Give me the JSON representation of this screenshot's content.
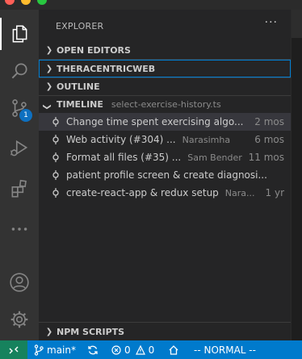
{
  "sidebar": {
    "title": "EXPLORER",
    "more_label": "···",
    "sections": {
      "open_editors": "OPEN EDITORS",
      "project": "THERACENTRICWEB",
      "outline": "OUTLINE",
      "timeline": "TIMELINE",
      "timeline_file": "select-exercise-history.ts",
      "npm_scripts": "NPM SCRIPTS"
    },
    "timeline_items": [
      {
        "title": "Change time spent exercising algo...",
        "author": "",
        "time": "2 mos"
      },
      {
        "title": "Web activity (#304) ...",
        "author": "Narasimha",
        "time": "6 mos"
      },
      {
        "title": "Format all files (#35) ...",
        "author": "Sam Bender",
        "time": "11 mos"
      },
      {
        "title": "patient profile screen & create diagnosi...",
        "author": "",
        "time": ""
      },
      {
        "title": "create-react-app & redux setup",
        "author": "Nara...",
        "time": "1 yr"
      }
    ]
  },
  "activity": {
    "scm_badge": "1"
  },
  "status": {
    "branch": "main*",
    "errors": "0",
    "warnings": "0",
    "mode": "-- NORMAL --"
  },
  "colors": {
    "statusbar": "#007acc",
    "remote": "#16825d",
    "focus_outline": "#007fd4"
  }
}
